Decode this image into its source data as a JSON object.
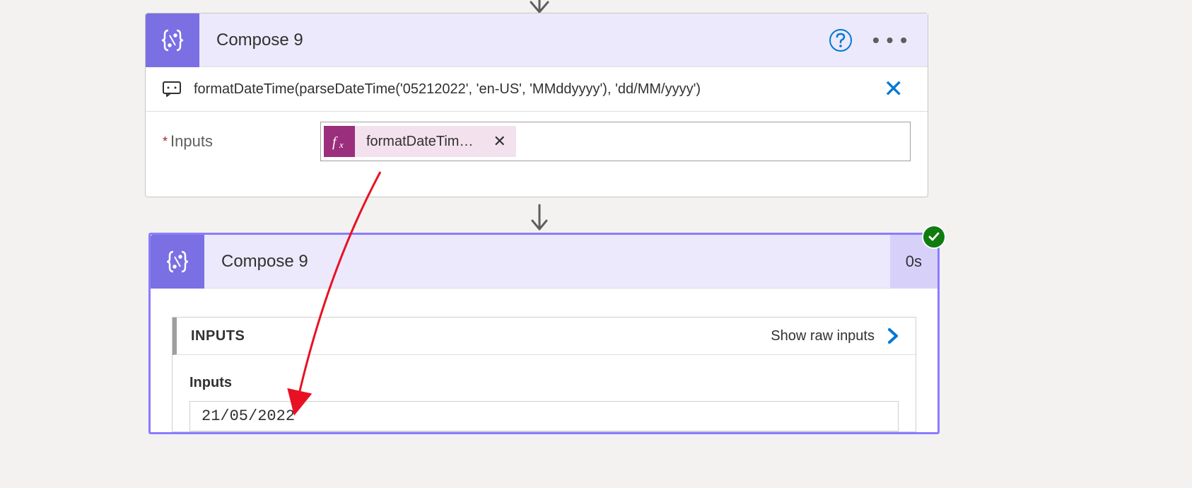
{
  "card1": {
    "title": "Compose 9",
    "comment": "formatDateTime(parseDateTime('05212022', 'en-US', 'MMddyyyy'), 'dd/MM/yyyy')",
    "inputsLabel": "Inputs",
    "chipLabel": "formatDateTim…"
  },
  "card2": {
    "title": "Compose 9",
    "duration": "0s",
    "sectionTitle": "INPUTS",
    "showRaw": "Show raw inputs",
    "bodyLabel": "Inputs",
    "value": "21/05/2022"
  }
}
